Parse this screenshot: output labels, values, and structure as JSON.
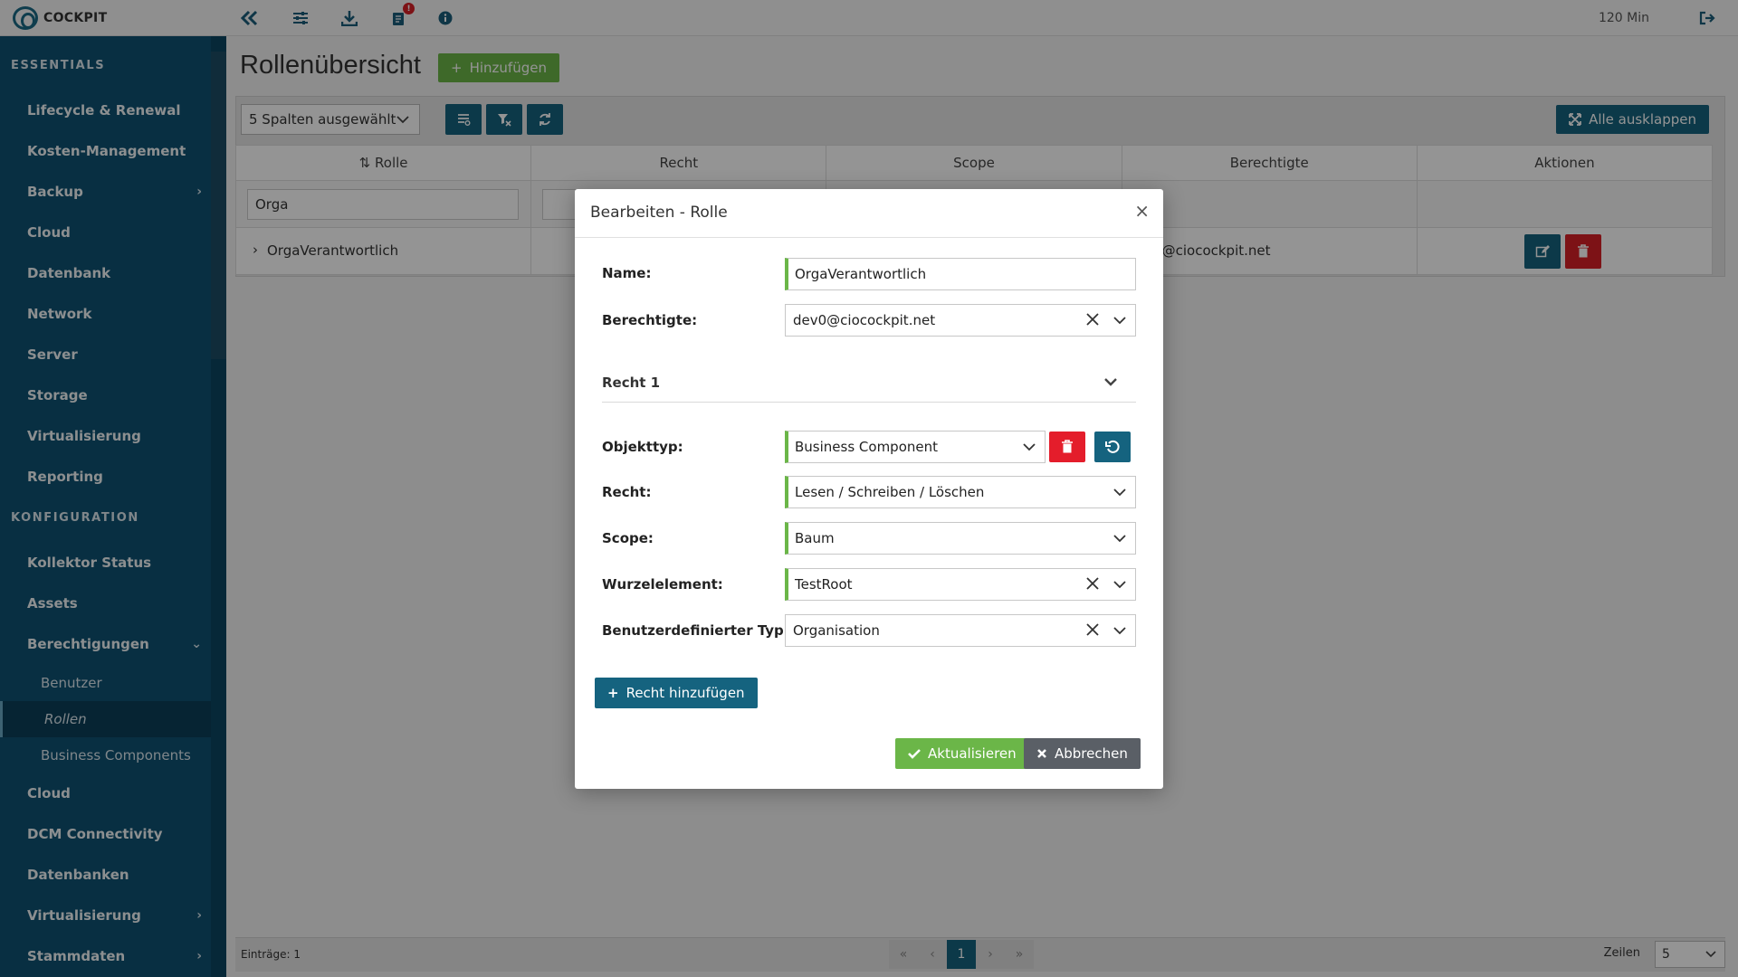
{
  "app": {
    "brand": "COCKPIT",
    "session": "120 Min",
    "notification_count": "!"
  },
  "colors": {
    "sidebar": "#0f5272",
    "primary": "#15637f",
    "success": "#6bb648",
    "danger": "#d81f26",
    "secondary": "#5a5f66"
  },
  "sidebar": {
    "section_essentials": "ESSENTIALS",
    "essentials": [
      {
        "label": "Lifecycle & Renewal"
      },
      {
        "label": "Kosten-Management"
      },
      {
        "label": "Backup"
      },
      {
        "label": "Cloud"
      },
      {
        "label": "Datenbank"
      },
      {
        "label": "Network"
      },
      {
        "label": "Server"
      },
      {
        "label": "Storage"
      },
      {
        "label": "Virtualisierung"
      },
      {
        "label": "Reporting"
      }
    ],
    "section_config": "KONFIGURATION",
    "config": [
      {
        "label": "Kollektor Status"
      },
      {
        "label": "Assets"
      },
      {
        "label": "Berechtigungen"
      }
    ],
    "sub": [
      {
        "label": "Benutzer"
      },
      {
        "label": "Rollen"
      },
      {
        "label": "Business Components"
      }
    ],
    "config_more": [
      {
        "label": "Cloud"
      },
      {
        "label": "DCM Connectivity"
      },
      {
        "label": "Datenbanken"
      },
      {
        "label": "Virtualisierung"
      },
      {
        "label": "Stammdaten"
      }
    ]
  },
  "page": {
    "title": "Rollenübersicht",
    "add_label": "Hinzufügen",
    "columns_select": "5 Spalten ausgewählt",
    "expand_label": "Alle ausklappen",
    "headers": [
      "Rolle",
      "Recht",
      "Scope",
      "Berechtigte",
      "Aktionen"
    ],
    "filter_rolle": "Orga",
    "row": {
      "rolle": "OrgaVerantwortlich",
      "berechtigte": "@ciocockpit.net"
    },
    "entries": "Einträge: 1",
    "page_current": "1",
    "rows_label": "Zeilen",
    "rows_value": "5"
  },
  "modal": {
    "title": "Bearbeiten - Rolle",
    "name_label": "Name:",
    "name_value": "OrgaVerantwortlich",
    "berechtigte_label": "Berechtigte:",
    "berechtigte_value": "dev0@ciocockpit.net",
    "section": "Recht 1",
    "objekttyp_label": "Objekttyp:",
    "objekttyp_value": "Business Component",
    "recht_label": "Recht:",
    "recht_value": "Lesen / Schreiben / Löschen",
    "scope_label": "Scope:",
    "scope_value": "Baum",
    "wurzel_label": "Wurzelelement:",
    "wurzel_value": "TestRoot",
    "typ_label": "Benutzerdefinierter Typ:",
    "typ_value": "Organisation",
    "add_recht": "Recht hinzufügen",
    "update": "Aktualisieren",
    "cancel": "Abbrechen"
  }
}
